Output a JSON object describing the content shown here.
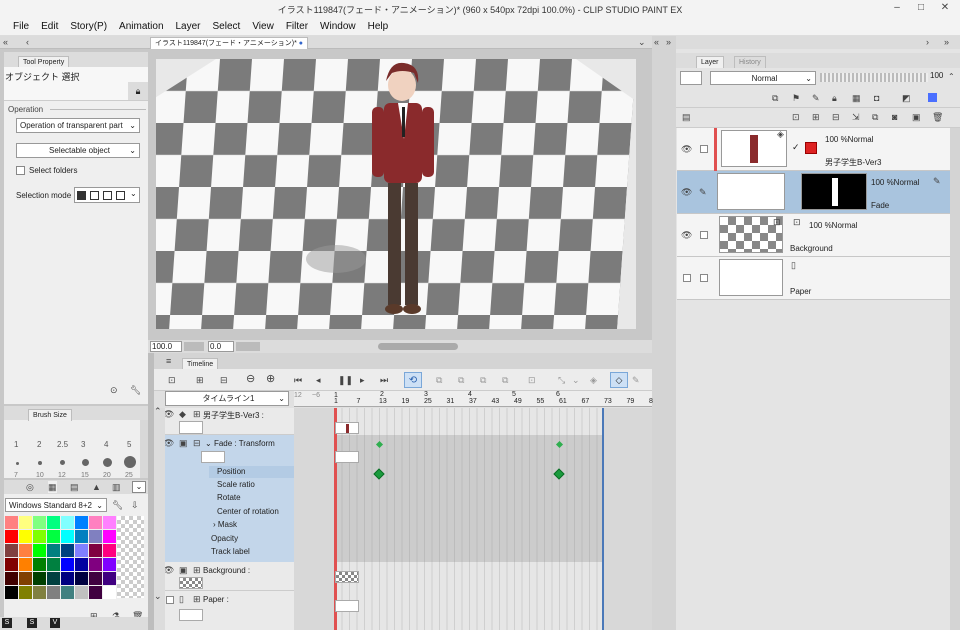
{
  "titlebar": {
    "title": "イラスト119847(フェード・アニメーション)* (960 x 540px 72dpi 100.0%)  - CLIP STUDIO PAINT EX"
  },
  "menu": [
    "File",
    "Edit",
    "Story(P)",
    "Animation",
    "Layer",
    "Select",
    "View",
    "Filter",
    "Window",
    "Help"
  ],
  "canvas_tab": {
    "label": "イラスト119847(フェード・アニメーション)*"
  },
  "tool_property": {
    "tab": "Tool Property",
    "tool_name": "オブジェクト 選択",
    "operation_label": "Operation",
    "operation_value": "Operation of transparent part",
    "selectable": "Selectable object",
    "select_folders": "Select folders",
    "selection_mode": "Selection mode"
  },
  "brush_size": {
    "tab": "Brush Size",
    "sizes_row1": [
      "1",
      "2",
      "2.5",
      "3",
      "4",
      "5"
    ],
    "sizes_row2": [
      "7",
      "10",
      "12",
      "15",
      "20",
      "25"
    ]
  },
  "color_set": {
    "value": "Windows Standard 8+2",
    "colors": [
      "#ff8080",
      "#ffff80",
      "#80ff80",
      "#00ff80",
      "#80ffff",
      "#0080ff",
      "#ff80c0",
      "#ff80ff",
      "#000000",
      "#ff0000",
      "#ffff00",
      "#80ff00",
      "#00ff40",
      "#00ffff",
      "#0080c0",
      "#8080c0",
      "#ff00ff",
      "#808080",
      "#804040",
      "#ff8040",
      "#00ff00",
      "#008080",
      "#004080",
      "#8080ff",
      "#800040",
      "#ff0080",
      "#c0c0c0",
      "#800000",
      "#ff8000",
      "#008000",
      "#008040",
      "#0000ff",
      "#0000a0",
      "#800080",
      "#8000ff",
      "#ffffff",
      "#400000",
      "#804000",
      "#004000",
      "#004040",
      "#000080",
      "#000040",
      "#400040",
      "#400080",
      "#ffffff",
      "#000000",
      "#808000",
      "#808040",
      "#808080",
      "#408080",
      "#c0c0c0",
      "#400040",
      "#ffffff",
      "#ffffff"
    ],
    "footer": [
      "S",
      "S",
      "V"
    ]
  },
  "zoom": {
    "value": "100.0",
    "rotate": "0.0"
  },
  "layers": {
    "tab_layer": "Layer",
    "tab_history": "History",
    "blend": "Normal",
    "opacity": "100",
    "rows": [
      {
        "opacity": "100 %Normal",
        "name": "男子学生B-Ver3"
      },
      {
        "opacity": "100 %Normal",
        "name": "Fade"
      },
      {
        "opacity": "100 %Normal",
        "name": "Background"
      },
      {
        "opacity": "",
        "name": "Paper"
      }
    ]
  },
  "timeline": {
    "tab": "Timeline",
    "name": "タイムライン1",
    "ruler": [
      "1",
      "7",
      "13",
      "19",
      "25",
      "31",
      "37",
      "43",
      "49",
      "55",
      "61",
      "67",
      "73",
      "79",
      "8"
    ],
    "ruler_small": [
      "12",
      "~6",
      "1",
      "2",
      "3",
      "4",
      "5",
      "6"
    ],
    "tracks": [
      {
        "name": "男子学生B-Ver3 :"
      },
      {
        "name": "Fade : Transform"
      },
      {
        "name": "Position"
      },
      {
        "name": "Scale ratio"
      },
      {
        "name": "Rotate"
      },
      {
        "name": "Center of rotation"
      },
      {
        "name": "Mask"
      },
      {
        "name": "Opacity"
      },
      {
        "name": "Track label"
      },
      {
        "name": "Background :"
      },
      {
        "name": "Paper :"
      }
    ]
  }
}
